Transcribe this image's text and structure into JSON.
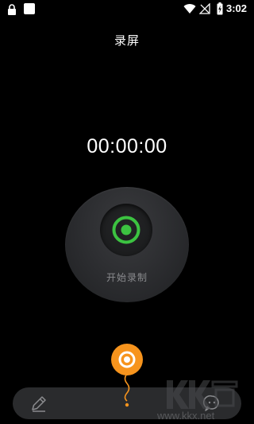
{
  "status_bar": {
    "time": "3:02",
    "icons": [
      "lock-icon",
      "notification-icon",
      "wifi-icon",
      "no-sim-icon",
      "battery-charging-icon"
    ]
  },
  "header": {
    "title": "录屏"
  },
  "recorder": {
    "elapsed": "00:00:00",
    "start_label": "开始录制",
    "accent_color": "#3cc341"
  },
  "bottom_bar": {
    "left_icon": "pencil-icon",
    "right_icon": "face-icon"
  },
  "floating_button": {
    "color": "#f7941d",
    "icon": "record-ring-icon"
  },
  "watermark": {
    "text": "www.kkx.net"
  }
}
